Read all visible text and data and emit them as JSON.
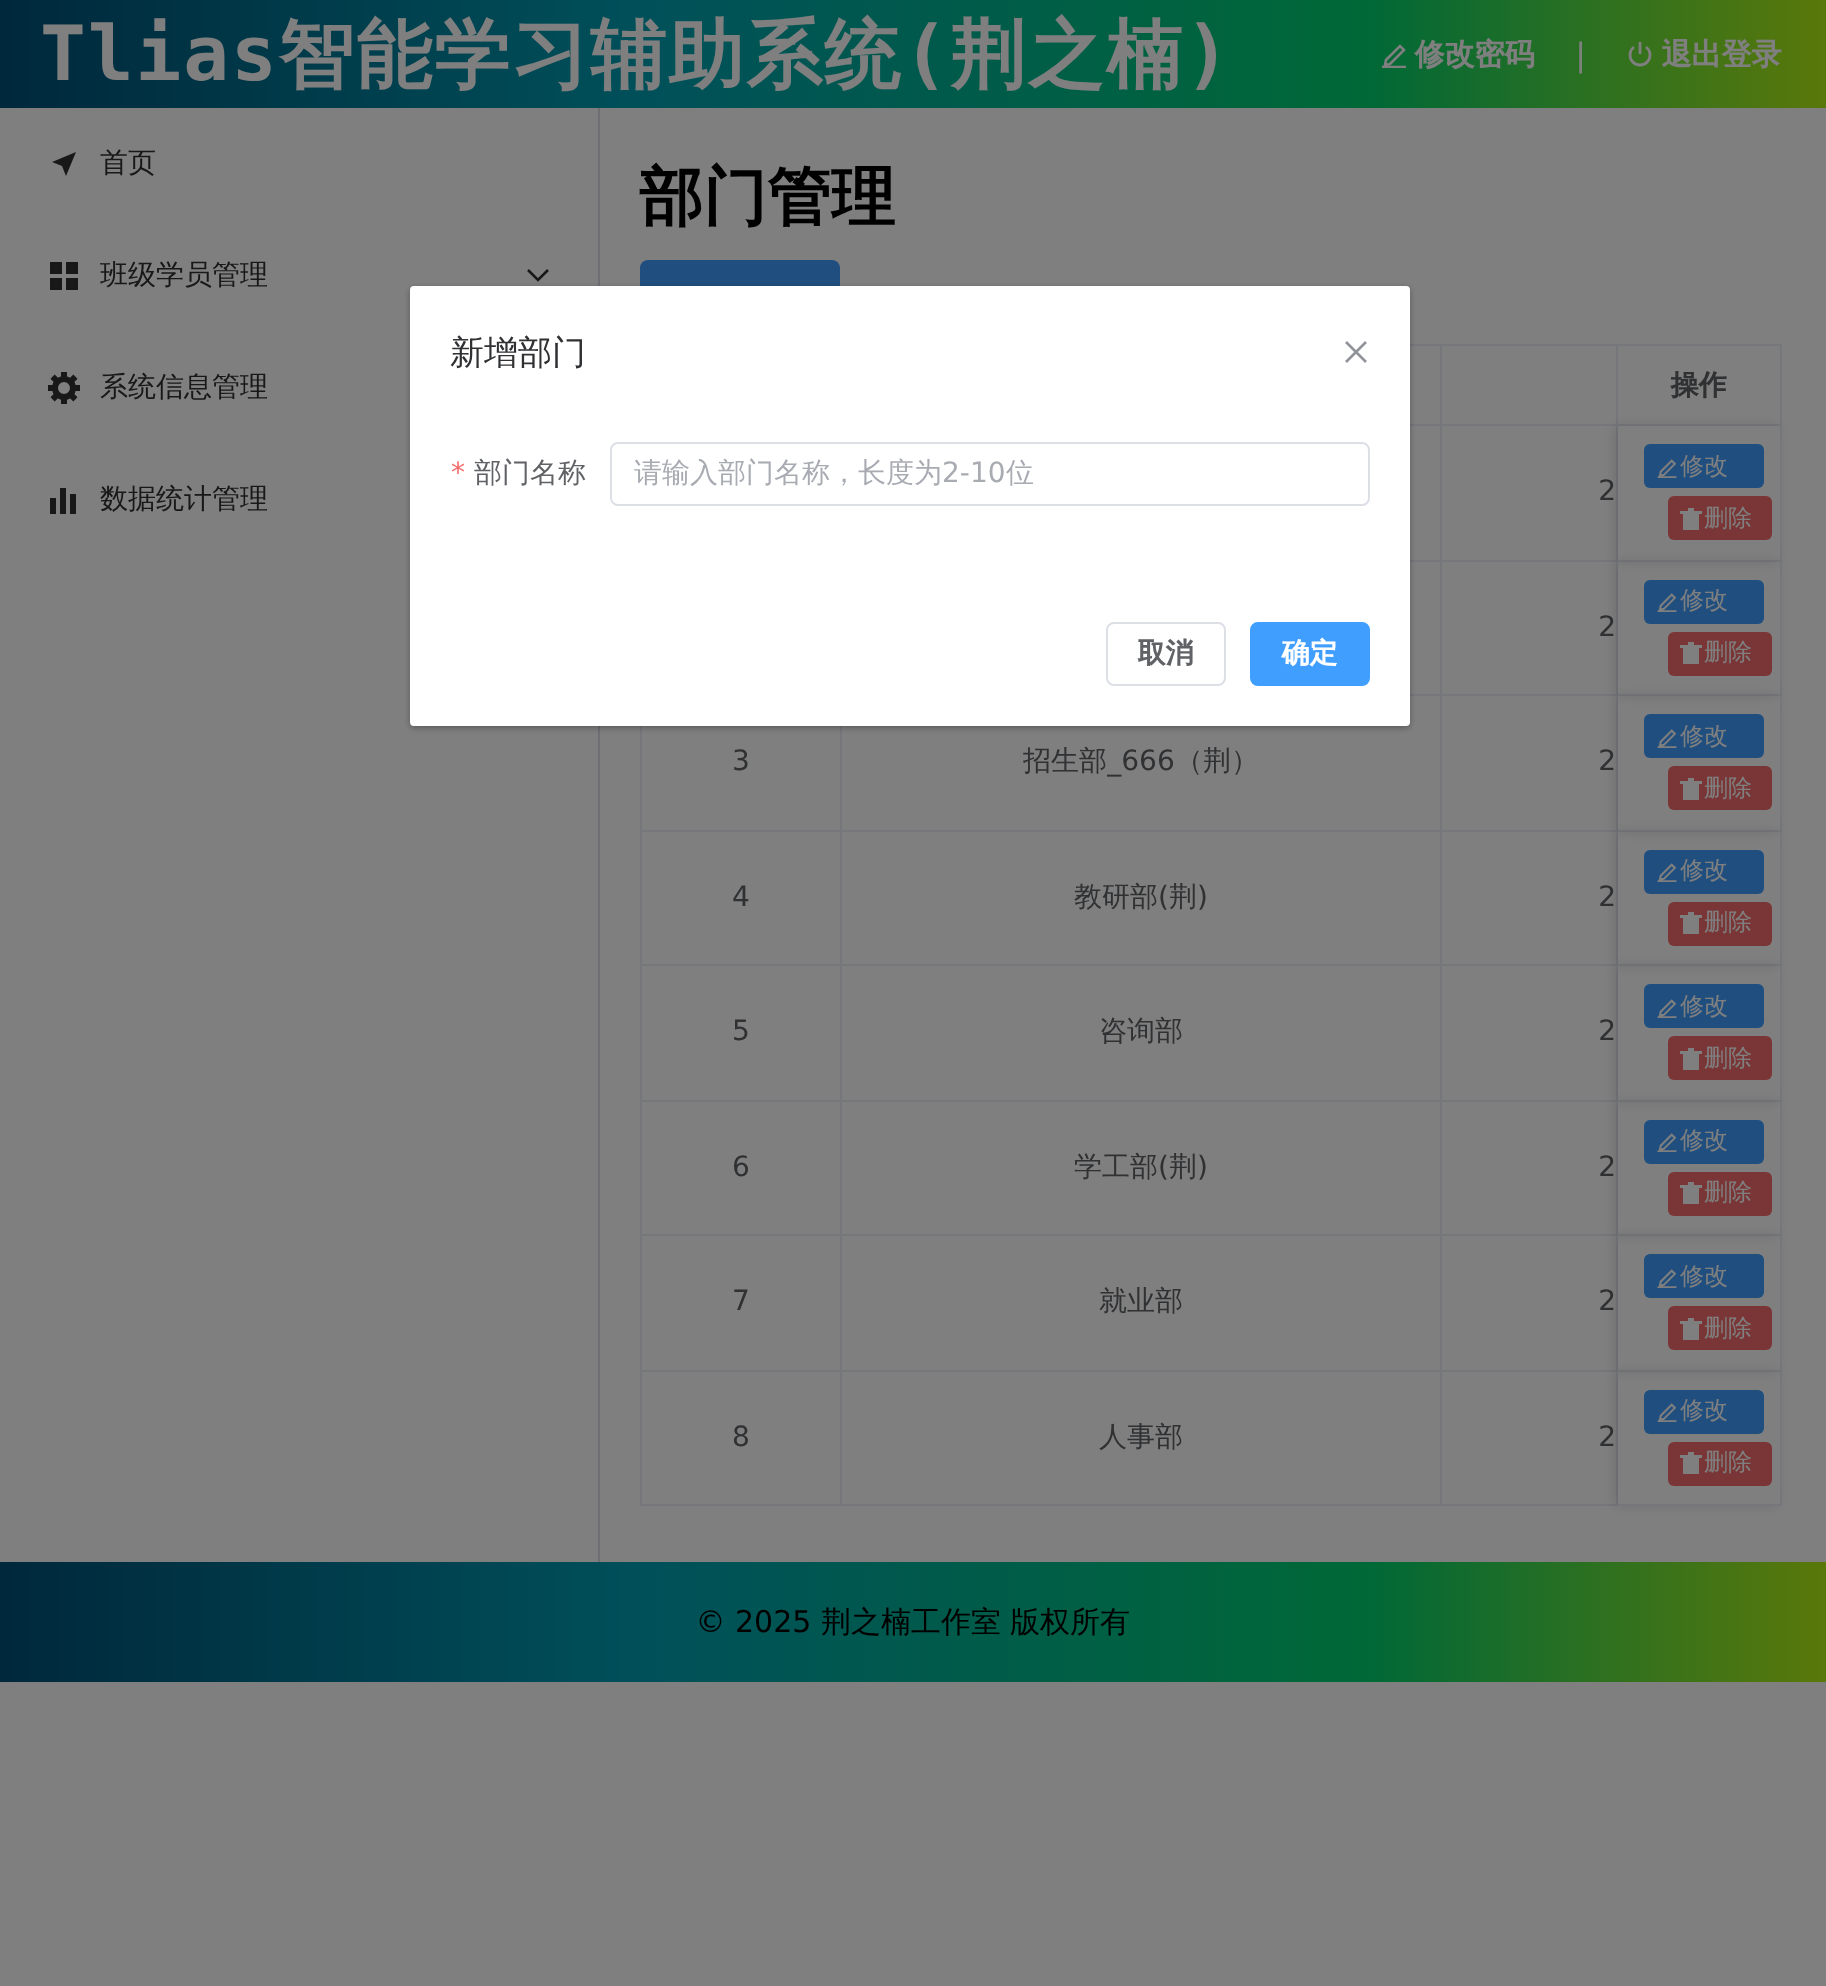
{
  "header": {
    "title": "Tlias智能学习辅助系统(荆之楠)",
    "actions": [
      {
        "kind": "edit",
        "label": "修改密码"
      },
      {
        "kind": "logout",
        "label": "退出登录"
      }
    ],
    "separator": "|"
  },
  "sidebar": {
    "items": [
      {
        "kind": "home",
        "label": "首页",
        "expandable": false
      },
      {
        "kind": "classes",
        "label": "班级学员管理",
        "expandable": true
      },
      {
        "kind": "system",
        "label": "系统信息管理"
      },
      {
        "kind": "stats",
        "label": "数据统计管理"
      }
    ]
  },
  "page": {
    "title": "部门管理"
  },
  "table": {
    "action_header": "操作",
    "rows": [
      {
        "column_3": "2",
        "edit": "修改",
        "delete": "删除"
      },
      {
        "column_3": "2",
        "edit": "修改",
        "delete": "删除"
      },
      {
        "number": "3",
        "name": "招生部_666（荆）",
        "column_3": "2",
        "edit": "修改",
        "delete": "删除"
      },
      {
        "number": "4",
        "name": "教研部(荆)",
        "column_3": "2",
        "edit": "修改",
        "delete": "删除"
      },
      {
        "number": "5",
        "name": "咨询部",
        "column_3": "2",
        "edit": "修改",
        "delete": "删除"
      },
      {
        "number": "6",
        "name": "学工部(荆)",
        "column_3": "2",
        "edit": "修改",
        "delete": "删除"
      },
      {
        "number": "7",
        "name": "就业部",
        "column_3": "2",
        "edit": "修改",
        "delete": "删除"
      },
      {
        "number": "8",
        "name": "人事部",
        "column_3": "2",
        "edit": "修改",
        "delete": "删除"
      }
    ]
  },
  "footer": {
    "text": "© 2025 荆之楠工作室 版权所有"
  },
  "dialog": {
    "title": "新增部门",
    "field": {
      "label": "部门名称",
      "required_mark": "*",
      "placeholder": "请输入部门名称，长度为2-10位"
    },
    "buttons": [
      {
        "kind": "cancel",
        "label": "取消"
      },
      {
        "kind": "primary",
        "label": "确定"
      }
    ]
  }
}
